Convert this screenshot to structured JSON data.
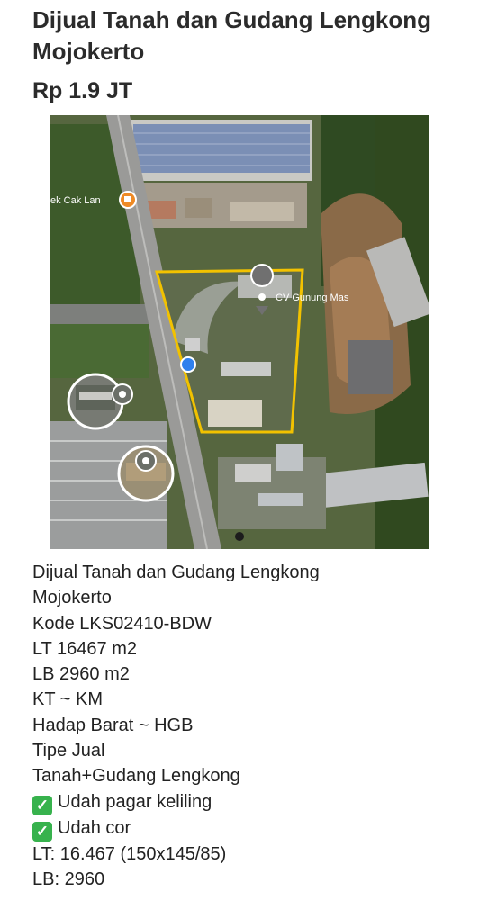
{
  "header": {
    "title": "Dijual Tanah dan Gudang Lengkong Mojokerto",
    "price": "Rp 1.9 JT"
  },
  "map": {
    "labels": {
      "place_left": "ek Cak Lan",
      "place_right": "CV Gunung Mas"
    },
    "colors": {
      "boundary": "#f2c200",
      "location_dot": "#2f80ed"
    }
  },
  "description": {
    "lines": [
      "Dijual Tanah dan Gudang Lengkong",
      "Mojokerto",
      "Kode LKS02410-BDW",
      "LT 16467 m2",
      "LB 2960 m2",
      "KT  ~  KM",
      "Hadap Barat ~ HGB",
      "Tipe Jual",
      "Tanah+Gudang Lengkong"
    ],
    "checks": [
      "Udah pagar keliling",
      "Udah cor"
    ],
    "footer_lines": [
      "LT: 16.467 (150x145/85)",
      "LB: 2960"
    ]
  }
}
